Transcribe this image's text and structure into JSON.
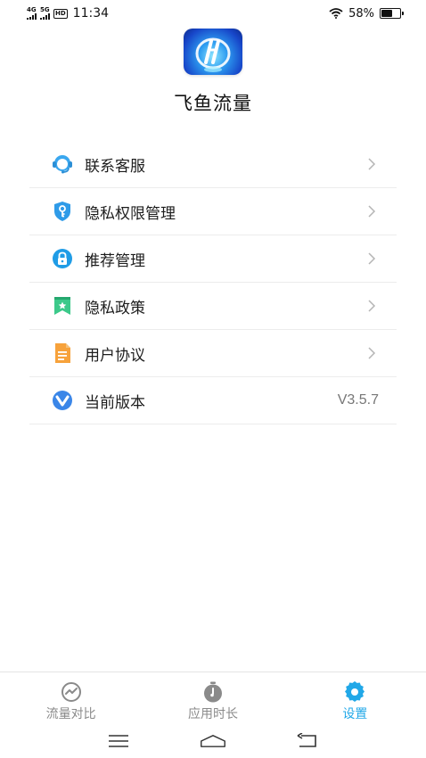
{
  "status_bar": {
    "signal1_label": "4G",
    "signal2_label": "5G",
    "hd_label": "HD",
    "time": "11:34",
    "battery_text": "58%",
    "battery_level": 0.58
  },
  "app": {
    "title": "飞鱼流量"
  },
  "menu": {
    "items": [
      {
        "label": "联系客服",
        "icon": "customer-service-icon"
      },
      {
        "label": "隐私权限管理",
        "icon": "shield-key-icon"
      },
      {
        "label": "推荐管理",
        "icon": "lock-icon"
      },
      {
        "label": "隐私政策",
        "icon": "bookmark-star-icon"
      },
      {
        "label": "用户协议",
        "icon": "document-icon"
      },
      {
        "label": "当前版本",
        "icon": "version-icon",
        "value": "V3.5.7"
      }
    ]
  },
  "tabs": [
    {
      "label": "流量对比",
      "icon": "trend-chart-icon",
      "active": false
    },
    {
      "label": "应用时长",
      "icon": "stopwatch-icon",
      "active": false
    },
    {
      "label": "设置",
      "icon": "gear-icon",
      "active": true
    }
  ],
  "colors": {
    "accent": "#21a8e8",
    "inactive_tab": "#8a8a8a",
    "divider": "#ececec"
  }
}
